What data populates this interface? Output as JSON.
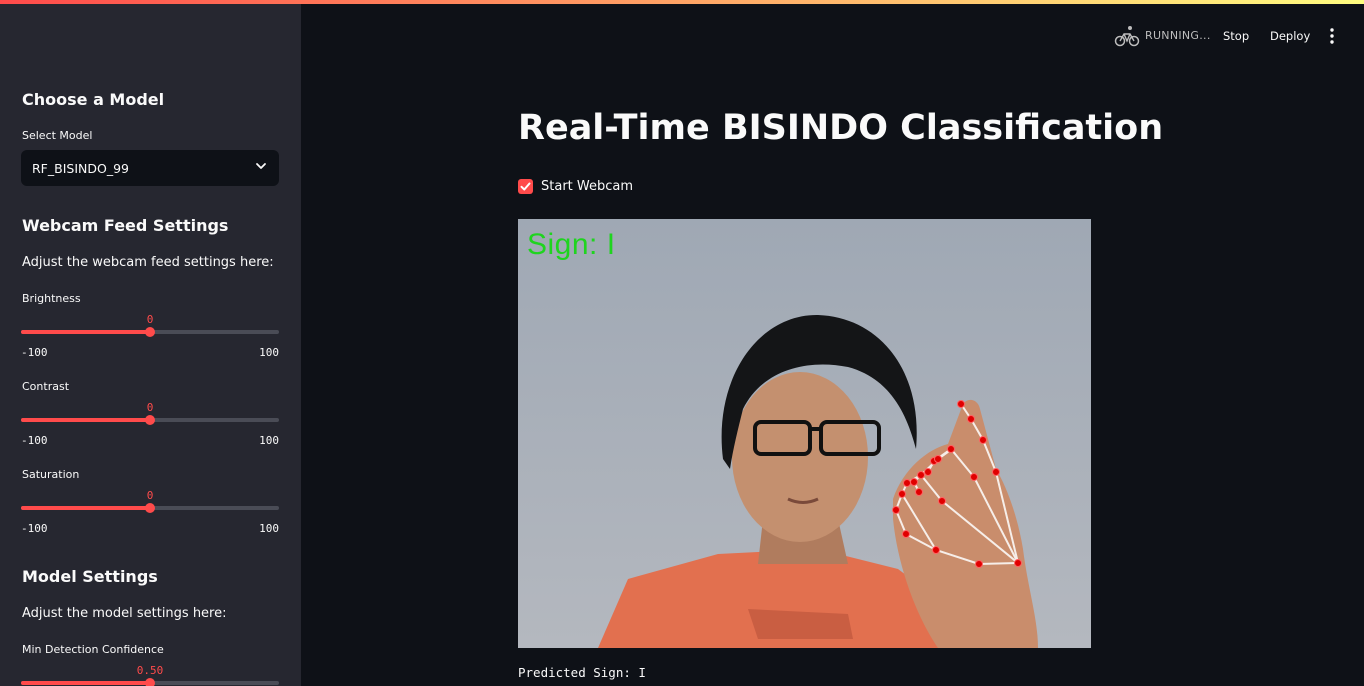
{
  "sidebar": {
    "model_heading": "Choose a Model",
    "select_label": "Select Model",
    "selected_model": "RF_BISINDO_99",
    "webcam_heading": "Webcam Feed Settings",
    "webcam_desc": "Adjust the webcam feed settings here:",
    "sliders": [
      {
        "label": "Brightness",
        "value": "0",
        "min": "-100",
        "max": "100",
        "fraction": 0.5
      },
      {
        "label": "Contrast",
        "value": "0",
        "min": "-100",
        "max": "100",
        "fraction": 0.5
      },
      {
        "label": "Saturation",
        "value": "0",
        "min": "-100",
        "max": "100",
        "fraction": 0.5
      }
    ],
    "model_settings_heading": "Model Settings",
    "model_settings_desc": "Adjust the model settings here:",
    "confidence": {
      "label": "Min Detection Confidence",
      "value": "0.50",
      "fraction": 0.5
    }
  },
  "header": {
    "status": "RUNNING...",
    "stop_label": "Stop",
    "deploy_label": "Deploy",
    "status_icon": "bicycle-running-icon",
    "menu_icon": "vertical-dots-menu-icon"
  },
  "main": {
    "title": "Real-Time BISINDO Classification",
    "checkbox_label": "Start Webcam",
    "checkbox_checked": true,
    "overlay_text": "Sign: I",
    "predicted": "Predicted Sign: I"
  },
  "colors": {
    "accent": "#ff4b4b",
    "background": "#0e1117",
    "sidebar": "#262730",
    "overlay_green": "#1fd41f"
  }
}
